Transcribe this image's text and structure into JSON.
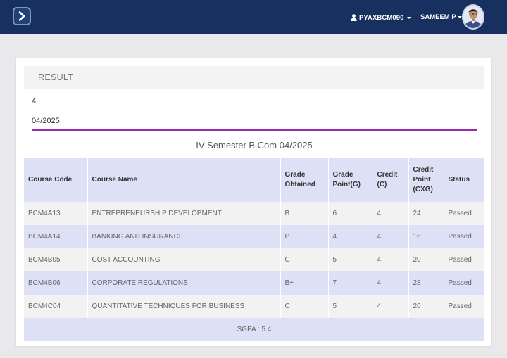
{
  "navbar": {
    "toggle_icon": "chevron-right-icon",
    "user_icon": "user-icon",
    "username": "PYAXBCM090",
    "display_name": "SAMEEM P",
    "colors": {
      "background": "#17305f",
      "button": "#20407a"
    }
  },
  "result": {
    "header": "RESULT",
    "semester_value": "4",
    "exam_value": "04/2025",
    "table_title": "IV Semester B.Com 04/2025",
    "columns": [
      "Course Code",
      "Course Name",
      "Grade Obtained",
      "Grade Point(G)",
      "Credit (C)",
      "Credit Point (CXG)",
      "Status"
    ],
    "rows": [
      {
        "code": "BCM4A13",
        "name": "ENTREPRENEURSHIP DEVELOPMENT",
        "grade": "B",
        "grade_point": "6",
        "credit": "4",
        "credit_point": "24",
        "status": "Passed"
      },
      {
        "code": "BCM4A14",
        "name": "BANKING AND INSURANCE",
        "grade": "P",
        "grade_point": "4",
        "credit": "4",
        "credit_point": "16",
        "status": "Passed"
      },
      {
        "code": "BCM4B05",
        "name": "COST ACCOUNTING",
        "grade": "C",
        "grade_point": "5",
        "credit": "4",
        "credit_point": "20",
        "status": "Passed"
      },
      {
        "code": "BCM4B06",
        "name": "CORPORATE REGULATIONS",
        "grade": "B+",
        "grade_point": "7",
        "credit": "4",
        "credit_point": "28",
        "status": "Passed"
      },
      {
        "code": "BCM4C04",
        "name": "QUANTITATIVE TECHNIQUES FOR BUSINESS",
        "grade": "C",
        "grade_point": "5",
        "credit": "4",
        "credit_point": "20",
        "status": "Passed"
      }
    ],
    "sgpa": "SGPA : 5.4",
    "colors": {
      "accent_underline": "#9c27b0",
      "header_row": "#dee0f6",
      "alt_row": "#f2f2f2"
    }
  }
}
